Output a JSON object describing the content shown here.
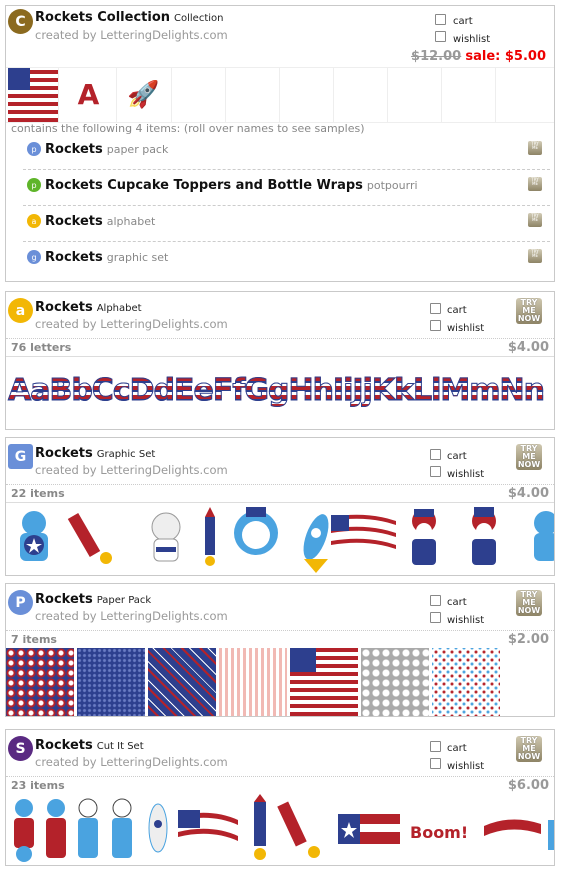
{
  "collection": {
    "name": "Rockets Collection",
    "type": "Collection",
    "created_by": "created by LetteringDelights.com",
    "cart_label": "cart",
    "wishlist_label": "wishlist",
    "old_price": "$12.00",
    "sale_price": "sale: $5.00",
    "contains_text": "contains the following 4 items: (roll over names to see samples)",
    "items": [
      {
        "name": "Rockets",
        "type": "paper pack",
        "icon": "paper-pack-icon"
      },
      {
        "name": "Rockets Cupcake Toppers and Bottle Wraps",
        "type": "potpourri",
        "icon": "potpourri-icon"
      },
      {
        "name": "Rockets",
        "type": "alphabet",
        "icon": "alphabet-icon"
      },
      {
        "name": "Rockets",
        "type": "graphic set",
        "icon": "graphic-set-icon"
      }
    ]
  },
  "products": [
    {
      "name": "Rockets",
      "type": "Alphabet",
      "created_by": "created by LetteringDelights.com",
      "cart_label": "cart",
      "wishlist_label": "wishlist",
      "count": "76 letters",
      "price": "$4.00",
      "try": "TRY ME NOW",
      "preview_text": "AaBbCcDdEeFfGgHhIiJjKkLlMmNn"
    },
    {
      "name": "Rockets",
      "type": "Graphic Set",
      "created_by": "created by LetteringDelights.com",
      "cart_label": "cart",
      "wishlist_label": "wishlist",
      "count": "22 items",
      "price": "$4.00",
      "try": "TRY ME NOW"
    },
    {
      "name": "Rockets",
      "type": "Paper Pack",
      "created_by": "created by LetteringDelights.com",
      "cart_label": "cart",
      "wishlist_label": "wishlist",
      "count": "7 items",
      "price": "$2.00",
      "try": "TRY ME NOW"
    },
    {
      "name": "Rockets",
      "type": "Cut It Set",
      "created_by": "created by LetteringDelights.com",
      "cart_label": "cart",
      "wishlist_label": "wishlist",
      "count": "23 items",
      "price": "$6.00",
      "try": "TRY ME NOW"
    }
  ],
  "colors": {
    "brand_brown": "#8b6a1f",
    "alphabet_yellow": "#f2b705",
    "graphic_blue": "#6a8fd8",
    "potpourri_green": "#5fb52a",
    "cutit_purple": "#5a2a82",
    "sale_red": "#e00000"
  }
}
